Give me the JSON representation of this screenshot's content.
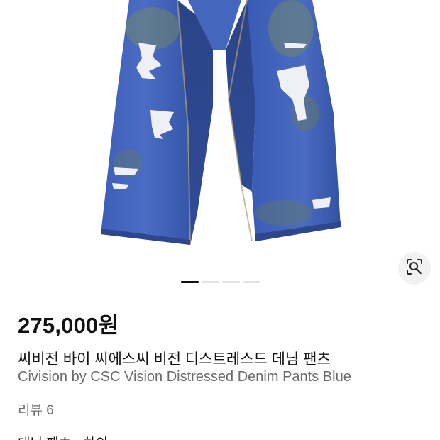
{
  "product": {
    "image_alt": "denim-pants-photo",
    "price": "275,000원",
    "title_ko": "씨비전 바이 씨에스씨 비전 디스트레스드 데님 팬츠",
    "title_en": "Civision by CSC Vision Distressed Denim Pants Blue",
    "reviews_label": "리뷰 6",
    "category_label": "데님 팬츠 · 하의"
  },
  "gallery": {
    "page_count": 4,
    "active_index": 0
  },
  "icons": {
    "lens": "lens-search-icon"
  },
  "colors": {
    "price_text": "#111111",
    "secondary_text": "#6b6b6b",
    "pager_active": "#111111",
    "pager_inactive": "#e3e3e3"
  }
}
